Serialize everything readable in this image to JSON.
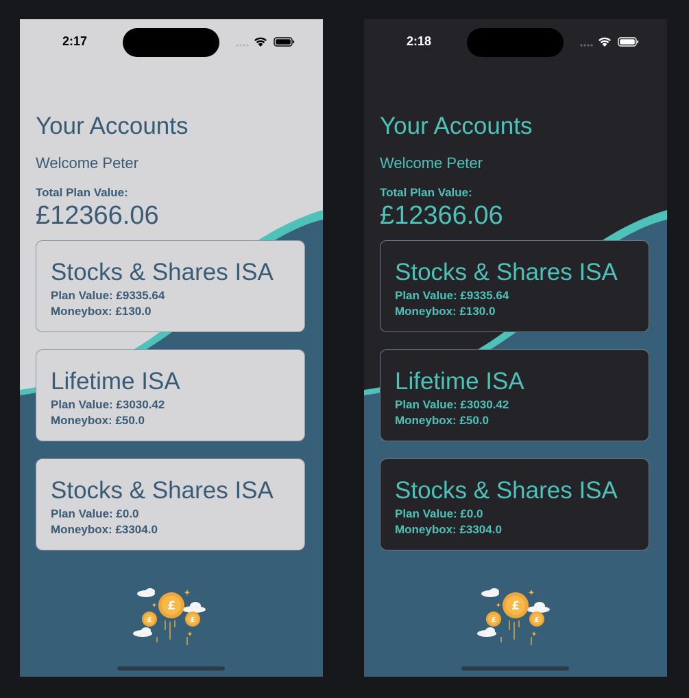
{
  "light": {
    "status_time": "2:17",
    "title": "Your Accounts",
    "welcome": "Welcome Peter",
    "total_label": "Total Plan Value:",
    "total_value": "£12366.06",
    "accounts": [
      {
        "name": "Stocks & Shares ISA",
        "plan_value": "Plan Value: £9335.64",
        "moneybox": "Moneybox: £130.0"
      },
      {
        "name": "Lifetime ISA",
        "plan_value": "Plan Value: £3030.42",
        "moneybox": "Moneybox: £50.0"
      },
      {
        "name": "Stocks & Shares ISA",
        "plan_value": "Plan Value: £0.0",
        "moneybox": "Moneybox: £3304.0"
      }
    ]
  },
  "dark": {
    "status_time": "2:18",
    "title": "Your Accounts",
    "welcome": "Welcome Peter",
    "total_label": "Total Plan Value:",
    "total_value": "£12366.06",
    "accounts": [
      {
        "name": "Stocks & Shares ISA",
        "plan_value": "Plan Value: £9335.64",
        "moneybox": "Moneybox: £130.0"
      },
      {
        "name": "Lifetime ISA",
        "plan_value": "Plan Value: £3030.42",
        "moneybox": "Moneybox: £50.0"
      },
      {
        "name": "Stocks & Shares ISA",
        "plan_value": "Plan Value: £0.0",
        "moneybox": "Moneybox: £3304.0"
      }
    ]
  },
  "icons": {
    "signal": "cellular-signal-icon",
    "wifi": "wifi-icon",
    "battery": "battery-icon",
    "logo": "moneybox-coins-logo"
  },
  "colors": {
    "light_background": "#d6d6d8",
    "dark_background": "#242328",
    "navy_wave": "#385f78",
    "teal_accent": "#4ec2b8",
    "light_text": "#3a5b75",
    "dark_text": "#4ec2b8"
  }
}
